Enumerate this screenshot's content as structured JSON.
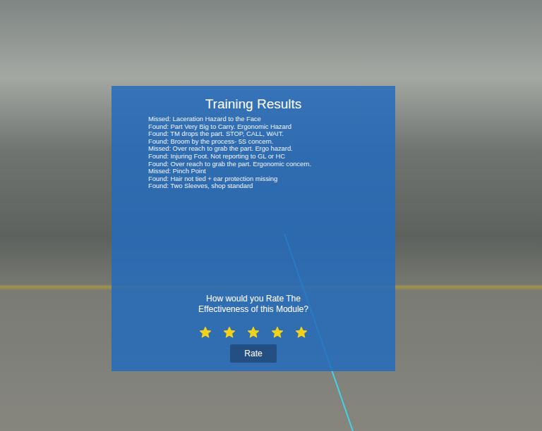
{
  "panel": {
    "title": "Training Results",
    "results": [
      "Missed: Laceration Hazard to the Face",
      "Found: Part Very Big to Carry. Ergonomic Hazard",
      "Found: TM drops the part. STOP, CALL, WAIT.",
      "Found: Broom by the process- 5S concern.",
      "Missed: Over reach to grab the part. Ergo hazard.",
      "Found: Injuring Foot. Not reporting to GL or HC",
      "Found: Over reach to grab the part. Ergonomic concern.",
      "Missed: Pinch Point",
      "Found: Hair not tied + ear protection missing",
      "Found: Two Sleeves, shop standard"
    ],
    "question": [
      "How would you Rate The",
      "Effectiveness of this Module?"
    ],
    "rating": {
      "stars": 5,
      "max": 5
    },
    "button": "Rate"
  }
}
